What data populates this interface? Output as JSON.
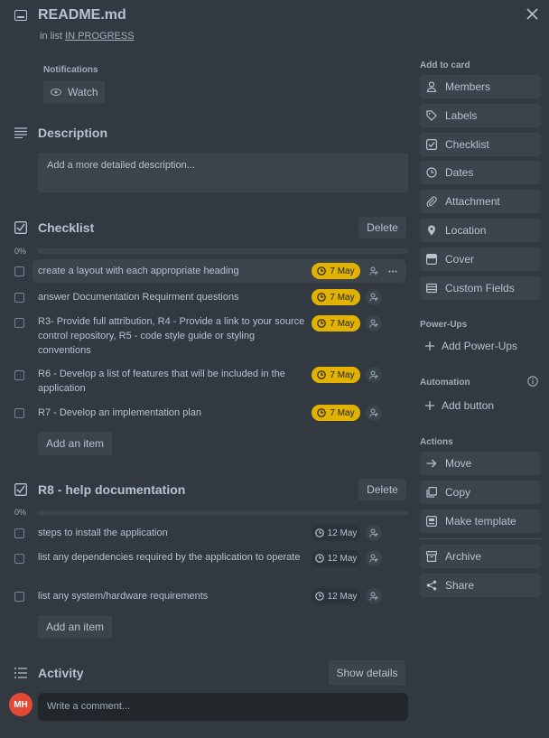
{
  "header": {
    "title": "README.md",
    "in_list_prefix": "in list",
    "list_name": "IN PROGRESS"
  },
  "notifications": {
    "label": "Notifications",
    "watch_label": "Watch"
  },
  "description": {
    "title": "Description",
    "placeholder": "Add a more detailed description..."
  },
  "checklists": [
    {
      "title": "Checklist",
      "delete_label": "Delete",
      "progress_label": "0%",
      "progress": 0,
      "add_item_label": "Add an item",
      "items": [
        {
          "text": "create a layout with each appropriate heading",
          "due": "7 May"
        },
        {
          "text": "answer Documentation Requirment questions",
          "due": "7 May"
        },
        {
          "text": "R3- Provide full attribution, R4 - Provide a link to your source control repository, R5 - code style guide or styling conventions",
          "due": "7 May"
        },
        {
          "text": "R6 - Develop a list of features that will be included in the application",
          "due": "7 May"
        },
        {
          "text": "R7 - Develop an implementation plan",
          "due": "7 May"
        }
      ]
    },
    {
      "title": "R8 - help documentation",
      "delete_label": "Delete",
      "progress_label": "0%",
      "progress": 0,
      "add_item_label": "Add an item",
      "items": [
        {
          "text": "steps to install the application",
          "due": "12 May"
        },
        {
          "text": "list any dependencies required by the application to operate",
          "due": "12 May"
        },
        {
          "text": "list any system/hardware requirements",
          "due": "12 May"
        }
      ]
    }
  ],
  "activity": {
    "title": "Activity",
    "show_details_label": "Show details",
    "avatar_initials": "MH",
    "comment_placeholder": "Write a comment..."
  },
  "sidebar": {
    "add_to_card_label": "Add to card",
    "add_to_card": [
      "Members",
      "Labels",
      "Checklist",
      "Dates",
      "Attachment",
      "Location",
      "Cover",
      "Custom Fields"
    ],
    "powerups_label": "Power-Ups",
    "add_powerups_label": "Add Power-Ups",
    "automation_label": "Automation",
    "add_button_label": "Add button",
    "actions_label": "Actions",
    "actions": [
      "Move",
      "Copy",
      "Make template",
      "Archive",
      "Share"
    ]
  },
  "colors": {
    "background": "#323940",
    "button": "#3b434b",
    "due_soon": "#e2b203",
    "avatar": "#e34935"
  }
}
